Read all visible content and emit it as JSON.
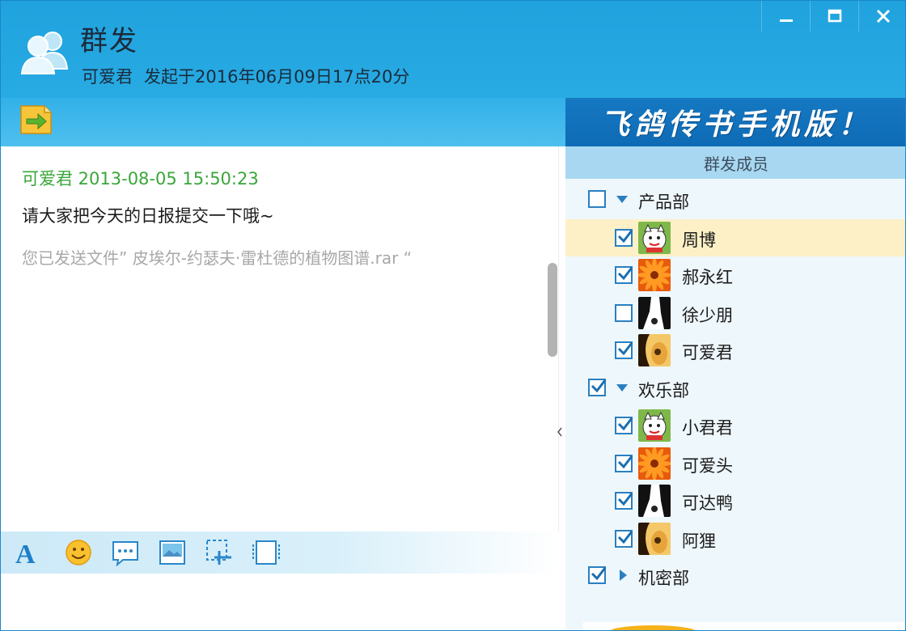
{
  "window": {
    "title": "群发",
    "sender": "可爱君",
    "started_at": "发起于2016年06月09日17点20分",
    "controls": [
      "minimize",
      "maximize",
      "close"
    ]
  },
  "chat": {
    "message_header": "可爱君 2013-08-05 15:50:23",
    "message_text": "请大家把今天的日报提交一下哦~",
    "system_notice": "您已发送文件” 皮埃尔-约瑟夫·雷杜德的植物图谱.rar “"
  },
  "toolbar": {
    "tools": [
      "font-icon",
      "emoji-icon",
      "bubble-icon",
      "image-icon",
      "screenshot-icon",
      "window-icon"
    ]
  },
  "right_panel": {
    "banner": "飞鸽传书手机版！",
    "members_header": "群发成员",
    "groups": [
      {
        "name": "产品部",
        "checked": false,
        "expanded": true,
        "members": [
          {
            "name": "周博",
            "checked": true,
            "avatar": "lucky-cat",
            "highlighted": true
          },
          {
            "name": "郝永红",
            "checked": true,
            "avatar": "orange-flower",
            "highlighted": false
          },
          {
            "name": "徐少朋",
            "checked": false,
            "avatar": "black-white-dog",
            "highlighted": false
          },
          {
            "name": "可爱君",
            "checked": true,
            "avatar": "guitar",
            "highlighted": false
          }
        ]
      },
      {
        "name": "欢乐部",
        "checked": true,
        "expanded": true,
        "members": [
          {
            "name": "小君君",
            "checked": true,
            "avatar": "lucky-cat",
            "highlighted": false
          },
          {
            "name": "可爱头",
            "checked": true,
            "avatar": "orange-flower",
            "highlighted": false
          },
          {
            "name": "可达鸭",
            "checked": true,
            "avatar": "black-white-dog",
            "highlighted": false
          },
          {
            "name": "阿狸",
            "checked": true,
            "avatar": "guitar",
            "highlighted": false
          }
        ]
      },
      {
        "name": "机密部",
        "checked": true,
        "expanded": false,
        "members": []
      }
    ]
  },
  "colors": {
    "titlebar": "#22a4df",
    "banner": "#1272bc",
    "members_header": "#a8d8f1",
    "highlight_row": "#fdf0c6",
    "message_header": "#3aa63a",
    "checkbox": "#2a7fc0"
  }
}
